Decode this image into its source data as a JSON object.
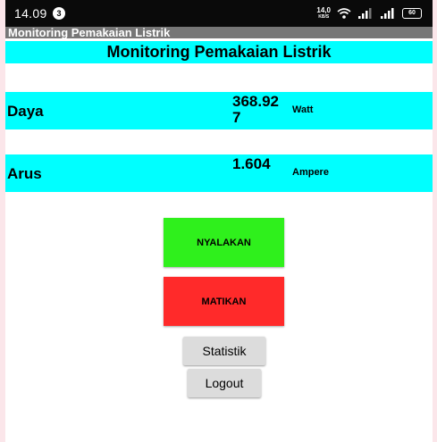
{
  "status_bar": {
    "time": "14.09",
    "notification_count": "3",
    "net_speed_value": "14,0",
    "net_speed_unit": "KB/S",
    "battery_level": "60"
  },
  "app_title": "Monitoring Pemakaian Listrik",
  "header": {
    "title": "Monitoring Pemakaian Listrik"
  },
  "readings": {
    "daya": {
      "label": "Daya",
      "value": "368.927",
      "unit": "Watt"
    },
    "arus": {
      "label": "Arus",
      "value": "1.604",
      "unit": "Ampere"
    }
  },
  "buttons": {
    "on": "NYALAKAN",
    "off": "MATIKAN",
    "statistik": "Statistik",
    "logout": "Logout"
  },
  "colors": {
    "accent_cyan": "#00ffff",
    "on_button": "#2ff01c",
    "off_button": "#ff2a2a",
    "title_bar": "#777777"
  }
}
